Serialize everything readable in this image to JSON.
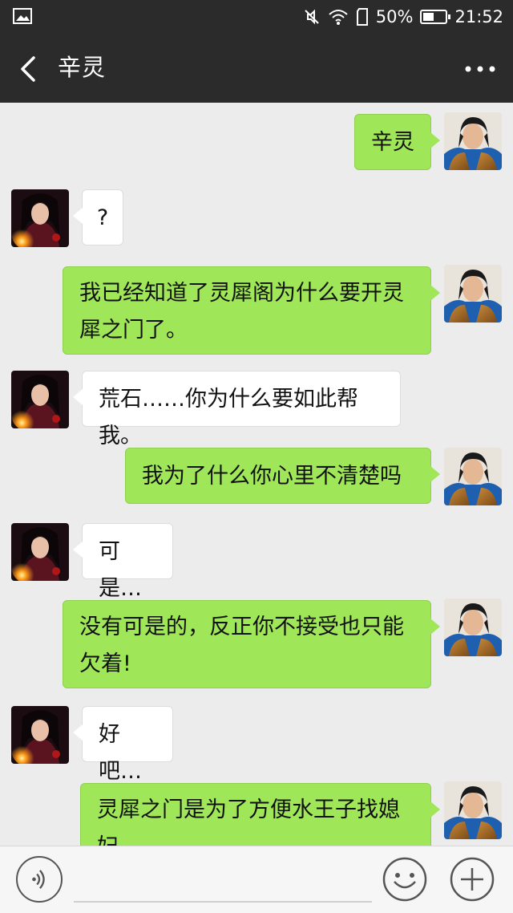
{
  "status_bar": {
    "battery_text": "50%",
    "battery_level": 0.5,
    "time": "21:52",
    "icons": [
      "image-icon",
      "mute-icon",
      "wifi-icon",
      "sim-icon",
      "battery-icon"
    ]
  },
  "header": {
    "back_icon": "back-chevron-icon",
    "title": "辛灵",
    "more_icon": "more-dots-icon"
  },
  "messages": [
    {
      "from": "me",
      "text": "辛灵"
    },
    {
      "from": "other",
      "text": "?"
    },
    {
      "from": "me",
      "line1": "我已经知道了灵犀阁为什么要开灵",
      "line2": "犀之门了。"
    },
    {
      "from": "other",
      "text": "荒石……你为什么要如此帮我。"
    },
    {
      "from": "me",
      "text": "我为了什么你心里不清楚吗"
    },
    {
      "from": "other",
      "text": "可是…"
    },
    {
      "from": "me",
      "line1": "没有可是的，反正你不接受也只能",
      "line2": "欠着!"
    },
    {
      "from": "other",
      "text": "好吧…"
    },
    {
      "from": "me",
      "line1": "灵犀之门是为了方便水王子找媳",
      "line2": "妇"
    }
  ],
  "input_bar": {
    "voice_icon": "voice-icon",
    "emoji_icon": "emoji-icon",
    "plus_icon": "plus-icon",
    "input_value": ""
  },
  "colors": {
    "header_bg": "#2b2b2b",
    "chat_bg": "#ececec",
    "outgoing_bubble": "#9fe658",
    "incoming_bubble": "#ffffff"
  }
}
